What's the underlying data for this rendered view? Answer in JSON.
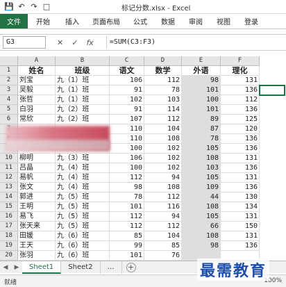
{
  "window": {
    "title": "标记分数.xlsx - Excel"
  },
  "quick_access": [
    "save-icon",
    "undo-icon",
    "redo-icon",
    "new-icon"
  ],
  "ribbon": {
    "tabs": [
      "文件",
      "开始",
      "插入",
      "页面布局",
      "公式",
      "数据",
      "审阅",
      "视图",
      "登录"
    ]
  },
  "formula_bar": {
    "name_box": "G3",
    "formula": "=SUM(C3:F3)"
  },
  "columns": [
    "A",
    "B",
    "C",
    "D",
    "E",
    "F"
  ],
  "header_row": [
    "姓名",
    "班级",
    "语文",
    "数学",
    "外语",
    "理化"
  ],
  "rows": [
    [
      "刘宝",
      "九（1）班",
      "106",
      "112",
      "98",
      "131"
    ],
    [
      "吴毅",
      "九（1）班",
      "91",
      "78",
      "101",
      "136"
    ],
    [
      "张哲",
      "九（1）班",
      "102",
      "103",
      "100",
      "112"
    ],
    [
      "白羽",
      "九（2）班",
      "91",
      "114",
      "101",
      "136"
    ],
    [
      "常欣",
      "九（2）班",
      "107",
      "112",
      "89",
      "125"
    ],
    [
      "",
      "",
      "110",
      "104",
      "87",
      "120"
    ],
    [
      "",
      "",
      "110",
      "108",
      "78",
      "136"
    ],
    [
      "",
      "",
      "100",
      "102",
      "105",
      "136"
    ],
    [
      "柳明",
      "九（3）班",
      "106",
      "102",
      "108",
      "131"
    ],
    [
      "吕晶",
      "九（4）班",
      "100",
      "102",
      "103",
      "136"
    ],
    [
      "易帆",
      "九（4）班",
      "112",
      "94",
      "105",
      "131"
    ],
    [
      "张文",
      "九（4）班",
      "98",
      "108",
      "109",
      "136"
    ],
    [
      "郭进",
      "九（5）班",
      "78",
      "112",
      "44",
      "130"
    ],
    [
      "王明",
      "九（5）班",
      "101",
      "116",
      "108",
      "134"
    ],
    [
      "易飞",
      "九（5）班",
      "112",
      "94",
      "105",
      "131"
    ],
    [
      "张天来",
      "九（5）班",
      "112",
      "112",
      "66",
      "150"
    ],
    [
      "田媛",
      "九（6）班",
      "85",
      "104",
      "108",
      "131"
    ],
    [
      "王天",
      "九（6）班",
      "99",
      "85",
      "98",
      "136"
    ],
    [
      "张羽",
      "九（6）班",
      "101",
      "76",
      "",
      ""
    ]
  ],
  "row_numbers": [
    "1",
    "2",
    "3",
    "4",
    "5",
    "6",
    "7",
    "8",
    "9",
    "10",
    "11",
    "12",
    "13",
    "14",
    "15",
    "16",
    "17",
    "18",
    "19",
    "20"
  ],
  "sheets": [
    "Sheet1",
    "Sheet2"
  ],
  "active_sheet": "Sheet1",
  "status": {
    "text": "就绪",
    "zoom": "100%"
  },
  "watermark": "最需教育",
  "colors": {
    "accent": "#217346",
    "shade": "#dedede",
    "watermark": "#1f4fa8"
  }
}
